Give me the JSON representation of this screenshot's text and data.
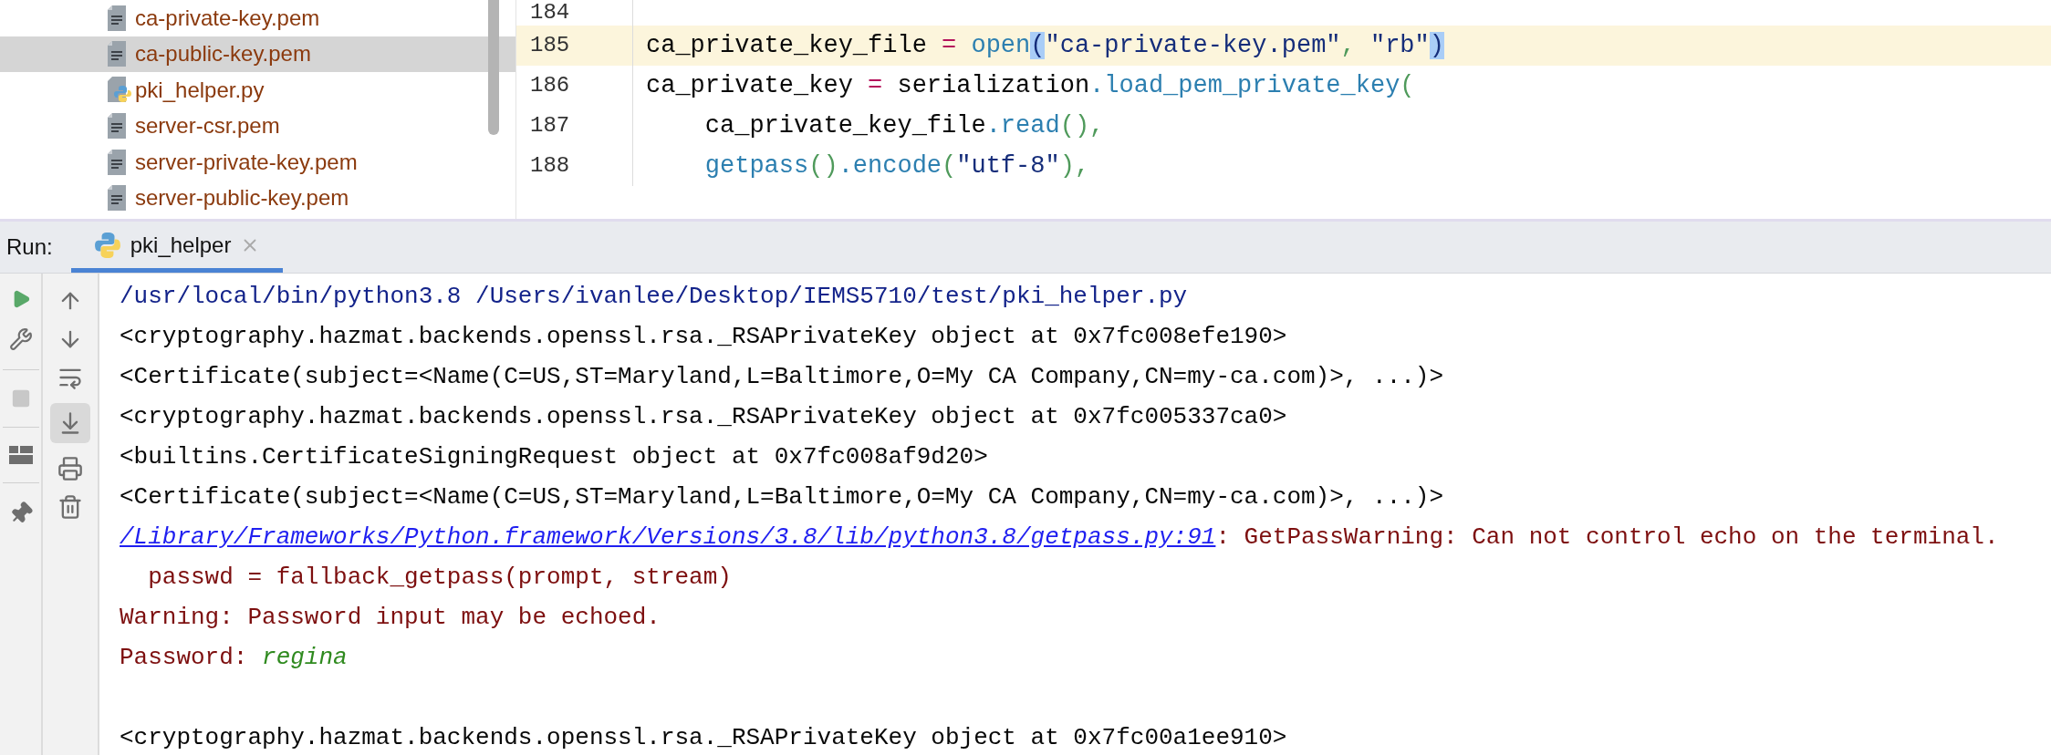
{
  "project_tree": {
    "files": [
      {
        "name": "ca-private-key.pem",
        "kind": "text",
        "selected": false
      },
      {
        "name": "ca-public-key.pem",
        "kind": "text",
        "selected": true
      },
      {
        "name": "pki_helper.py",
        "kind": "python",
        "selected": false
      },
      {
        "name": "server-csr.pem",
        "kind": "text",
        "selected": false
      },
      {
        "name": "server-private-key.pem",
        "kind": "text",
        "selected": false
      },
      {
        "name": "server-public-key.pem",
        "kind": "text",
        "selected": false
      }
    ]
  },
  "editor": {
    "lines": [
      {
        "number": "184",
        "current": false
      },
      {
        "number": "185",
        "current": true,
        "tokens": [
          {
            "text": "ca_private_key_file ",
            "kind": "plain"
          },
          {
            "text": "=",
            "kind": "operator"
          },
          {
            "text": " open",
            "kind": "call"
          },
          {
            "text": "(",
            "kind": "brace-match"
          },
          {
            "text": "\"ca-private-key.pem\"",
            "kind": "string"
          },
          {
            "text": ", ",
            "kind": "punct"
          },
          {
            "text": "\"rb\"",
            "kind": "string"
          },
          {
            "text": ")",
            "kind": "brace-match"
          }
        ]
      },
      {
        "number": "186",
        "current": false,
        "tokens": [
          {
            "text": "ca_private_key ",
            "kind": "plain"
          },
          {
            "text": "=",
            "kind": "operator"
          },
          {
            "text": " serialization",
            "kind": "plain"
          },
          {
            "text": ".load_pem_private_key",
            "kind": "call"
          },
          {
            "text": "(",
            "kind": "punct"
          }
        ]
      },
      {
        "number": "187",
        "current": false,
        "tokens": [
          {
            "text": "    ca_private_key_file",
            "kind": "plain"
          },
          {
            "text": ".read",
            "kind": "call"
          },
          {
            "text": "(),",
            "kind": "punct"
          }
        ]
      },
      {
        "number": "188",
        "current": false,
        "tokens": [
          {
            "text": "    getpass",
            "kind": "call"
          },
          {
            "text": "()",
            "kind": "punct"
          },
          {
            "text": ".encode",
            "kind": "call"
          },
          {
            "text": "(",
            "kind": "punct"
          },
          {
            "text": "\"utf-8\"",
            "kind": "string"
          },
          {
            "text": "),",
            "kind": "punct"
          }
        ]
      }
    ]
  },
  "run_panel": {
    "label": "Run:",
    "tabs": [
      {
        "label": "pki_helper",
        "selected": true
      }
    ],
    "autoscroll_on": true,
    "console": [
      {
        "segments": [
          {
            "text": "/usr/local/bin/python3.8 /Users/ivanlee/Desktop/IEMS5710/test/pki_helper.py",
            "kind": "command"
          }
        ]
      },
      {
        "segments": [
          {
            "text": "<cryptography.hazmat.backends.openssl.rsa._RSAPrivateKey object at 0x7fc008efe190>",
            "kind": "stdout"
          }
        ]
      },
      {
        "segments": [
          {
            "text": "<Certificate(subject=<Name(C=US,ST=Maryland,L=Baltimore,O=My CA Company,CN=my-ca.com)>, ...)>",
            "kind": "stdout"
          }
        ]
      },
      {
        "segments": [
          {
            "text": "<cryptography.hazmat.backends.openssl.rsa._RSAPrivateKey object at 0x7fc005337ca0>",
            "kind": "stdout"
          }
        ]
      },
      {
        "segments": [
          {
            "text": "<builtins.CertificateSigningRequest object at 0x7fc008af9d20>",
            "kind": "stdout"
          }
        ]
      },
      {
        "segments": [
          {
            "text": "<Certificate(subject=<Name(C=US,ST=Maryland,L=Baltimore,O=My CA Company,CN=my-ca.com)>, ...)>",
            "kind": "stdout"
          }
        ]
      },
      {
        "segments": [
          {
            "text": "/Library/Frameworks/Python.framework/Versions/3.8/lib/python3.8/getpass.py:91",
            "kind": "link"
          },
          {
            "text": ": GetPassWarning: Can not control echo on the terminal.",
            "kind": "stderr"
          }
        ]
      },
      {
        "segments": [
          {
            "text": "  passwd = fallback_getpass(prompt, stream)",
            "kind": "stderr"
          }
        ]
      },
      {
        "segments": [
          {
            "text": "Warning: Password input may be echoed.",
            "kind": "stderr"
          }
        ]
      },
      {
        "segments": [
          {
            "text": "Password: ",
            "kind": "stderr"
          },
          {
            "text": "regina",
            "kind": "input"
          }
        ]
      },
      {
        "kind": "blank"
      },
      {
        "segments": [
          {
            "text": "<cryptography.hazmat.backends.openssl.rsa._RSAPrivateKey object at 0x7fc00a1ee910>",
            "kind": "stdout"
          }
        ]
      }
    ]
  }
}
